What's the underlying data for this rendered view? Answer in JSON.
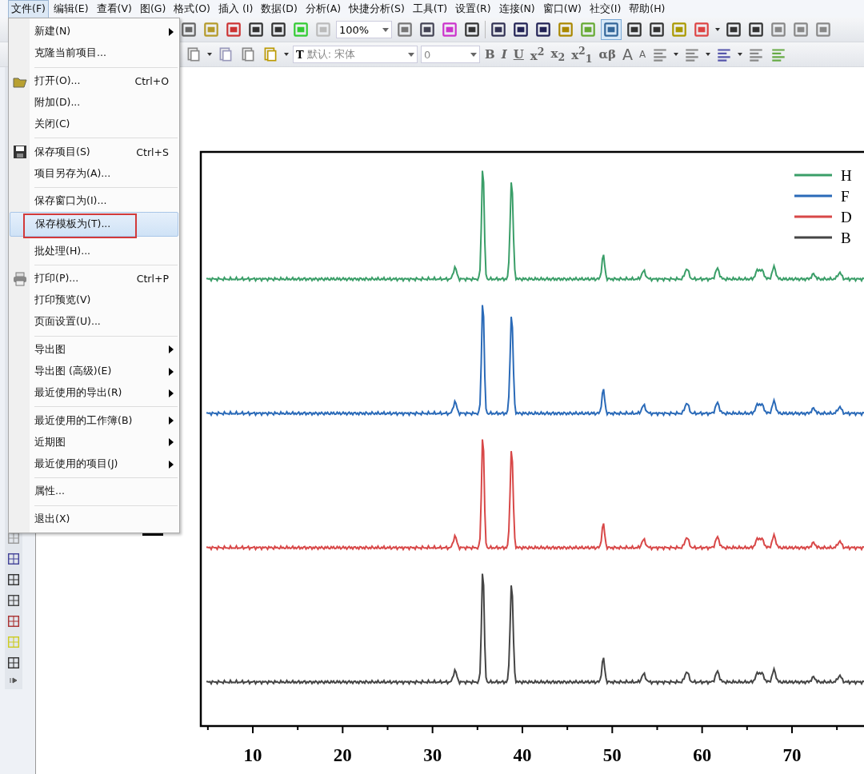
{
  "menu_bar": [
    {
      "label": "文件(F)",
      "selected": true
    },
    {
      "label": "编辑(E)",
      "selected": false
    },
    {
      "label": "查看(V)",
      "selected": false
    },
    {
      "label": "图(G)",
      "selected": false
    },
    {
      "label": "格式(O)",
      "selected": false
    },
    {
      "label": "插入 (I)",
      "selected": false
    },
    {
      "label": "数据(D)",
      "selected": false
    },
    {
      "label": "分析(A)",
      "selected": false
    },
    {
      "label": "快捷分析(S)",
      "selected": false
    },
    {
      "label": "工具(T)",
      "selected": false
    },
    {
      "label": "设置(R)",
      "selected": false
    },
    {
      "label": "连接(N)",
      "selected": false
    },
    {
      "label": "窗口(W)",
      "selected": false
    },
    {
      "label": "社交(I)",
      "selected": false
    },
    {
      "label": "帮助(H)",
      "selected": false
    }
  ],
  "toolbar": {
    "zoom": "100%",
    "font_icon": "T",
    "font": "默认: 宋体",
    "font_size": "0",
    "format_buttons": [
      "B",
      "I",
      "U",
      "x$^{2}$",
      "x$_{2}$",
      "x$^{2}$$_{1}$",
      "αβ",
      "A",
      "A"
    ]
  },
  "file_menu": [
    {
      "kind": "item",
      "label": "新建(N)",
      "submenu": true,
      "selected": false,
      "outlined": false
    },
    {
      "kind": "item",
      "label": "克隆当前项目...",
      "submenu": false,
      "selected": false,
      "outlined": false
    },
    {
      "kind": "separator"
    },
    {
      "kind": "item",
      "label": "打开(O)...",
      "shortcut": "Ctrl+O",
      "submenu": false,
      "selected": false,
      "outlined": false
    },
    {
      "kind": "item",
      "label": "附加(D)...",
      "submenu": false,
      "selected": false,
      "outlined": false
    },
    {
      "kind": "item",
      "label": "关闭(C)",
      "submenu": false,
      "selected": false,
      "outlined": false
    },
    {
      "kind": "separator"
    },
    {
      "kind": "item",
      "label": "保存项目(S)",
      "shortcut": "Ctrl+S",
      "submenu": false,
      "selected": false,
      "outlined": false
    },
    {
      "kind": "item",
      "label": "项目另存为(A)...",
      "submenu": false,
      "selected": false,
      "outlined": false
    },
    {
      "kind": "separator"
    },
    {
      "kind": "item",
      "label": "保存窗口为(I)...",
      "submenu": false,
      "selected": false,
      "outlined": false
    },
    {
      "kind": "item",
      "label": "保存模板为(T)...",
      "submenu": false,
      "selected": true,
      "outlined": true
    },
    {
      "kind": "item",
      "label": "批处理(H)...",
      "submenu": false,
      "selected": false,
      "outlined": false
    },
    {
      "kind": "separator"
    },
    {
      "kind": "item",
      "label": "打印(P)...",
      "shortcut": "Ctrl+P",
      "submenu": false,
      "selected": false,
      "outlined": false
    },
    {
      "kind": "item",
      "label": "打印预览(V)",
      "submenu": false,
      "selected": false,
      "outlined": false
    },
    {
      "kind": "item",
      "label": "页面设置(U)...",
      "submenu": false,
      "selected": false,
      "outlined": false
    },
    {
      "kind": "separator"
    },
    {
      "kind": "item",
      "label": "导出图",
      "submenu": true,
      "selected": false,
      "outlined": false
    },
    {
      "kind": "item",
      "label": "导出图 (高级)(E)",
      "submenu": true,
      "selected": false,
      "outlined": false
    },
    {
      "kind": "item",
      "label": "最近使用的导出(R)",
      "submenu": true,
      "selected": false,
      "outlined": false
    },
    {
      "kind": "separator"
    },
    {
      "kind": "item",
      "label": "最近使用的工作簿(B)",
      "submenu": true,
      "selected": false,
      "outlined": false
    },
    {
      "kind": "item",
      "label": "近期图",
      "submenu": true,
      "selected": false,
      "outlined": false
    },
    {
      "kind": "item",
      "label": "最近使用的项目(J)",
      "submenu": true,
      "selected": false,
      "outlined": false
    },
    {
      "kind": "separator"
    },
    {
      "kind": "item",
      "label": "属性...",
      "submenu": false,
      "selected": false,
      "outlined": false
    },
    {
      "kind": "separator"
    },
    {
      "kind": "item",
      "label": "退出(X)",
      "submenu": false,
      "selected": false,
      "outlined": false
    }
  ],
  "graph": {
    "legend": [
      {
        "label": "H",
        "color": "#3a9e68"
      },
      {
        "label": "F",
        "color": "#2a6ab8"
      },
      {
        "label": "D",
        "color": "#d84848"
      },
      {
        "label": "B",
        "color": "#454545"
      }
    ],
    "x_tick_labels": [
      "10",
      "20",
      "30",
      "40",
      "50",
      "60",
      "70"
    ]
  }
}
